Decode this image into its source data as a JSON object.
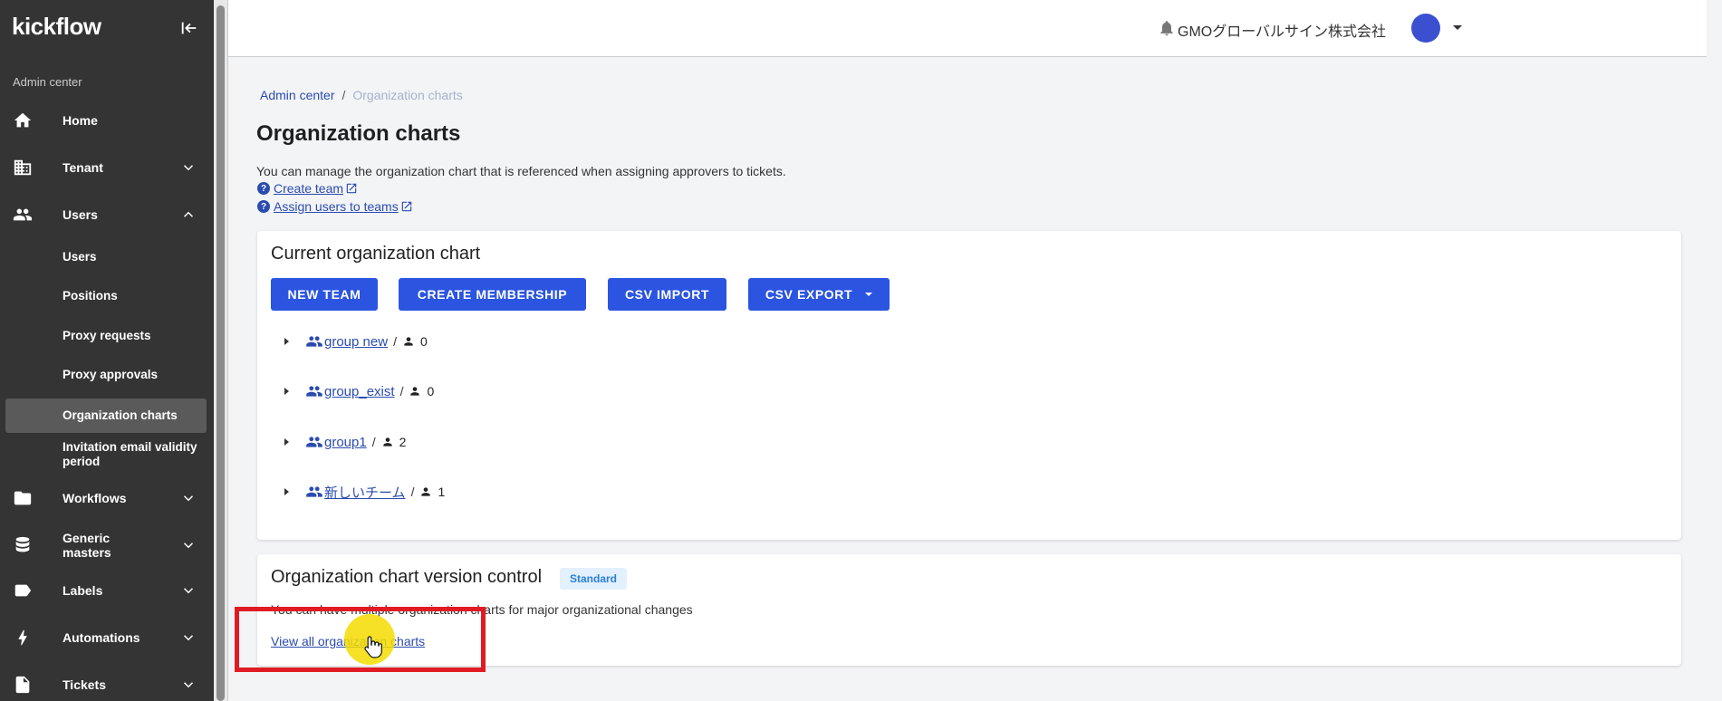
{
  "sidebar": {
    "logo": "kickflow",
    "section_label": "Admin center",
    "items": [
      {
        "label": "Home",
        "icon": "home-icon",
        "expandable": false
      },
      {
        "label": "Tenant",
        "icon": "building-icon",
        "expandable": true,
        "expanded": false
      },
      {
        "label": "Users",
        "icon": "people-icon",
        "expandable": true,
        "expanded": true
      },
      {
        "label": "Workflows",
        "icon": "folder-icon",
        "expandable": true,
        "expanded": false
      },
      {
        "label": "Generic masters",
        "icon": "database-icon",
        "expandable": true,
        "expanded": false
      },
      {
        "label": "Labels",
        "icon": "label-icon",
        "expandable": true,
        "expanded": false
      },
      {
        "label": "Automations",
        "icon": "bolt-icon",
        "expandable": true,
        "expanded": false
      },
      {
        "label": "Tickets",
        "icon": "document-icon",
        "expandable": true,
        "expanded": false
      }
    ],
    "users_subitems": [
      {
        "label": "Users"
      },
      {
        "label": "Positions"
      },
      {
        "label": "Proxy requests"
      },
      {
        "label": "Proxy approvals"
      },
      {
        "label": "Organization charts",
        "active": true
      },
      {
        "label": "Invitation email validity period"
      }
    ]
  },
  "topbar": {
    "org_name": "GMOグローバルサイン株式会社",
    "avatar_color": "#3b4fd1"
  },
  "breadcrumb": {
    "parent": "Admin center",
    "separator": "/",
    "current": "Organization charts"
  },
  "page": {
    "title": "Organization charts",
    "description": "You can manage the organization chart that is referenced when assigning approvers to tickets.",
    "help_links": [
      "Create team",
      "Assign users to teams"
    ]
  },
  "current_chart": {
    "title": "Current organization chart",
    "buttons": [
      "NEW TEAM",
      "CREATE MEMBERSHIP",
      "CSV IMPORT",
      "CSV EXPORT"
    ],
    "teams": [
      {
        "name": "group new",
        "separator": "/",
        "members": "0"
      },
      {
        "name": "group_exist",
        "separator": "/",
        "members": "0"
      },
      {
        "name": "group1",
        "separator": "/",
        "members": "2"
      },
      {
        "name": "新しいチーム",
        "separator": "/",
        "members": "1"
      }
    ]
  },
  "version_control": {
    "title": "Organization chart version control",
    "badge": "Standard",
    "description": "You can have multiple organization charts for major organizational changes",
    "link": "View all organization charts"
  },
  "colors": {
    "sidebar_bg": "#343434",
    "primary": "#2b55e0",
    "link": "#2b4bb0",
    "highlight": "#e01b24",
    "cursor_highlight": "#f5dc00"
  }
}
